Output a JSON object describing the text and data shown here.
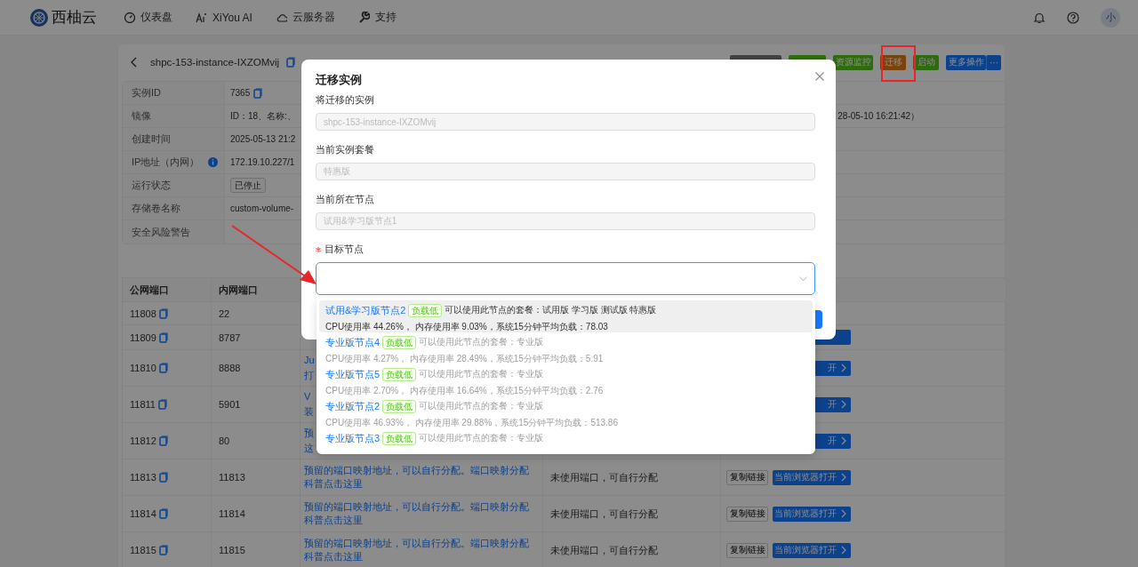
{
  "nav": {
    "logo": "西柚云",
    "items": [
      {
        "label": "仪表盘"
      },
      {
        "label": "XiYou AI"
      },
      {
        "label": "云服务器"
      },
      {
        "label": "支持"
      }
    ],
    "avatar": "小"
  },
  "instance": {
    "title": "shpc-153-instance-IXZOMvij",
    "actions": [
      {
        "kind": "dark"
      },
      {
        "kind": "green"
      },
      {
        "kind": "green",
        "label": "资源监控"
      },
      {
        "kind": "orange",
        "label": "迁移"
      },
      {
        "kind": "green",
        "label": "启动"
      },
      {
        "kind": "blue",
        "label": "更多操作",
        "more": "···"
      }
    ],
    "details": [
      {
        "label": "实例ID",
        "value": "7365",
        "copy": true
      },
      {
        "label": "镜像",
        "value": "ID：18、名称:、",
        "tail": "28-05-10 16:21:42）"
      },
      {
        "label": "创建时间",
        "value": "2025-05-13 21:2"
      },
      {
        "label": "IP地址（内网）",
        "value": "172.19.10.227/1",
        "info": true
      },
      {
        "label": "运行状态",
        "value": "已停止",
        "kind": "tag"
      },
      {
        "label": "存储卷名称",
        "value": "custom-volume-"
      },
      {
        "label": "安全风险警告"
      }
    ]
  },
  "ports": {
    "columns": [
      "公网端口",
      "内网端口"
    ],
    "rows": [
      {
        "public": "11808",
        "private": "22"
      },
      {
        "public": "11809",
        "private": "8787",
        "open": ""
      },
      {
        "public": "11810",
        "private": "8888",
        "fragments": [
          "Ju",
          "打"
        ],
        "open": "开"
      },
      {
        "public": "11811",
        "private": "5901",
        "fragments": [
          "V",
          "装"
        ],
        "open": "开"
      },
      {
        "public": "11812",
        "private": "80",
        "fragments": [
          "预",
          "这"
        ],
        "open": "开"
      },
      {
        "public": "11813",
        "private": "11813",
        "description": "预留的端口映射地址，可以自行分配。端口映射分配科普点击这里",
        "status": "未使用端口，可自行分配",
        "copy": "复制链接",
        "open": "当前浏览器打开"
      },
      {
        "public": "11814",
        "private": "11814",
        "description": "预留的端口映射地址，可以自行分配。端口映射分配科普点击这里",
        "status": "未使用端口，可自行分配",
        "copy": "复制链接",
        "open": "当前浏览器打开"
      },
      {
        "public": "11815",
        "private": "11815",
        "description": "预留的端口映射地址，可以自行分配。端口映射分配科普点击这里",
        "status": "未使用端口，可自行分配",
        "copy": "复制链接",
        "open": "当前浏览器打开"
      }
    ]
  },
  "modal": {
    "title": "迁移实例",
    "fields": [
      {
        "label": "将迁移的实例",
        "value": "shpc-153-instance-IXZOMvij",
        "disabled": true
      },
      {
        "label": "当前实例套餐",
        "value": "特惠版",
        "disabled": true
      },
      {
        "label": "当前所在节点",
        "value": "试用&学习版节点1",
        "disabled": true
      },
      {
        "label": "目标节点",
        "kind": "select",
        "required": true,
        "focused": true
      }
    ],
    "confirm": {
      "kind": "primary"
    },
    "options": [
      {
        "name": "试用&学习版节点2",
        "tag": "负载低",
        "plans": "可以使用此节点的套餐：试用版 学习版 测试版 特惠版",
        "stats": "CPU使用率 44.26%， 内存使用率 9.03%，系统15分钟平均负载：78.03",
        "highlighted": true,
        "disabled": false
      },
      {
        "name": "专业版节点4",
        "tag": "负载低",
        "plans": "可以使用此节点的套餐：专业版",
        "stats": "CPU使用率 4.27%， 内存使用率 28.49%，系统15分钟平均负载：5.91",
        "highlighted": false,
        "disabled": true
      },
      {
        "name": "专业版节点5",
        "tag": "负载低",
        "plans": "可以使用此节点的套餐：专业版",
        "stats": "CPU使用率 2.70%， 内存使用率 16.64%，系统15分钟平均负载：2.76",
        "highlighted": false,
        "disabled": true
      },
      {
        "name": "专业版节点2",
        "tag": "负载低",
        "plans": "可以使用此节点的套餐：专业版",
        "stats": "CPU使用率 46.93%， 内存使用率 29.88%，系统15分钟平均负载：513.86",
        "highlighted": false,
        "disabled": true
      },
      {
        "name": "专业版节点3",
        "tag": "负载低",
        "plans": "可以使用此节点的套餐：专业版",
        "highlighted": false,
        "disabled": true
      }
    ]
  },
  "annotations": {
    "box": true,
    "arrow": true
  }
}
